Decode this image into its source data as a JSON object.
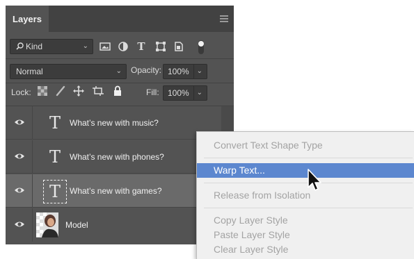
{
  "panel": {
    "tab_title": "Layers",
    "filter": {
      "kind_label": "Kind"
    },
    "blend": {
      "mode": "Normal",
      "opacity_label": "Opacity:",
      "opacity_value": "100%"
    },
    "lock": {
      "label": "Lock:",
      "fill_label": "Fill:",
      "fill_value": "100%"
    },
    "layers": [
      {
        "type": "text",
        "name": "What’s new with music?"
      },
      {
        "type": "text",
        "name": "What’s new with phones?"
      },
      {
        "type": "text",
        "name": "What’s new with games?",
        "selected": true
      },
      {
        "type": "image",
        "name": "Model"
      }
    ],
    "text_glyph": "T",
    "colors": {
      "panel_bg": "#535353",
      "tab_bg": "#424242",
      "selected_row": "#6a6a6a"
    }
  },
  "context_menu": {
    "items": [
      {
        "label": "Convert Text Shape Type",
        "enabled": false
      },
      {
        "label": "Warp Text...",
        "enabled": true,
        "highlighted": true
      },
      {
        "label": "Release from Isolation",
        "enabled": false
      },
      {
        "label": "Copy Layer Style",
        "enabled": false
      },
      {
        "label": "Paste Layer Style",
        "enabled": false
      },
      {
        "label": "Clear Layer Style",
        "enabled": false
      }
    ],
    "colors": {
      "highlight": "#5c87cf",
      "disabled_text": "#a3a3a3"
    }
  }
}
